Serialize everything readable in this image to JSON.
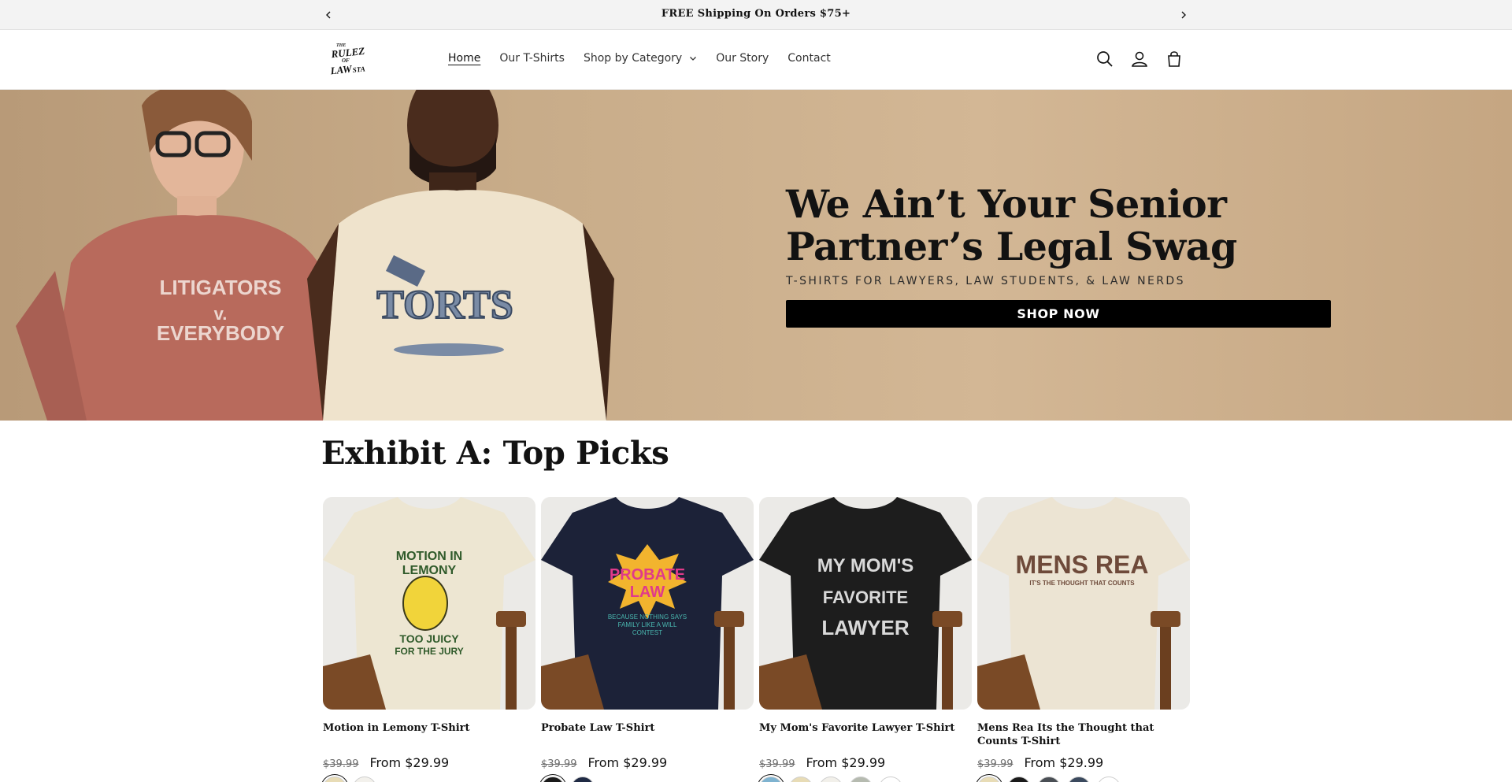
{
  "announcement": {
    "text": "FREE Shipping On Orders $75+"
  },
  "header": {
    "logo_text": [
      "THE",
      "RULEZ",
      "OF",
      "LAW",
      "STA"
    ],
    "nav": [
      {
        "label": "Home",
        "active": true
      },
      {
        "label": "Our T-Shirts",
        "active": false
      },
      {
        "label": "Shop by Category",
        "active": false,
        "has_dropdown": true
      },
      {
        "label": "Our Story",
        "active": false
      },
      {
        "label": "Contact",
        "active": false
      }
    ],
    "icons": [
      "search-icon",
      "account-icon",
      "cart-icon"
    ]
  },
  "hero": {
    "title": "We Ain’t Your Senior Partner’s Legal Swag",
    "subtitle": "T-SHIRTS FOR LAWYERS, LAW STUDENTS, & LAW NERDS",
    "cta": "SHOP NOW",
    "shirt_left_text": [
      "LITIGATORS",
      "v.",
      "EVERYBODY"
    ],
    "shirt_right_text": "TORTS"
  },
  "section": {
    "title": "Exhibit A: Top Picks",
    "products": [
      {
        "title": "Motion in Lemony T-Shirt",
        "price_old": "$39.99",
        "price_new": "From $29.99",
        "shirt_color": "#ede6d2",
        "print_lines": [
          "MOTION IN",
          "LEMONY",
          "TOO JUICY",
          "FOR THE JURY"
        ],
        "swatches": [
          "#e8dcb6",
          "#f3f1ec"
        ]
      },
      {
        "title": "Probate Law T-Shirt",
        "price_old": "$39.99",
        "price_new": "From $29.99",
        "shirt_color": "#1c2238",
        "print_lines": [
          "PROBATE",
          "LAW",
          "BECAUSE NOTHING SAYS",
          "FAMILY LIKE A WILL",
          "CONTEST"
        ],
        "swatches": [
          "#1a1a1a",
          "#1f2a44"
        ]
      },
      {
        "title": "My Mom's Favorite Lawyer T-Shirt",
        "price_old": "$39.99",
        "price_new": "From $29.99",
        "shirt_color": "#1d1d1d",
        "print_lines": [
          "MY MOM'S",
          "FAVORITE",
          "LAWYER"
        ],
        "swatches": [
          "#7fb3d0",
          "#e8dcb6",
          "#f2f0ea",
          "#b6bbb0",
          "#ffffff"
        ]
      },
      {
        "title": "Mens Rea Its the Thought that Counts T-Shirt",
        "price_old": "$39.99",
        "price_new": "From $29.99",
        "shirt_color": "#ece4d3",
        "print_lines": [
          "MENS REA",
          "IT'S THE THOUGHT THAT COUNTS"
        ],
        "swatches": [
          "#e8dcb6",
          "#1a1a1a",
          "#4a4f55",
          "#3b4a5e",
          "#ffffff"
        ]
      }
    ]
  }
}
